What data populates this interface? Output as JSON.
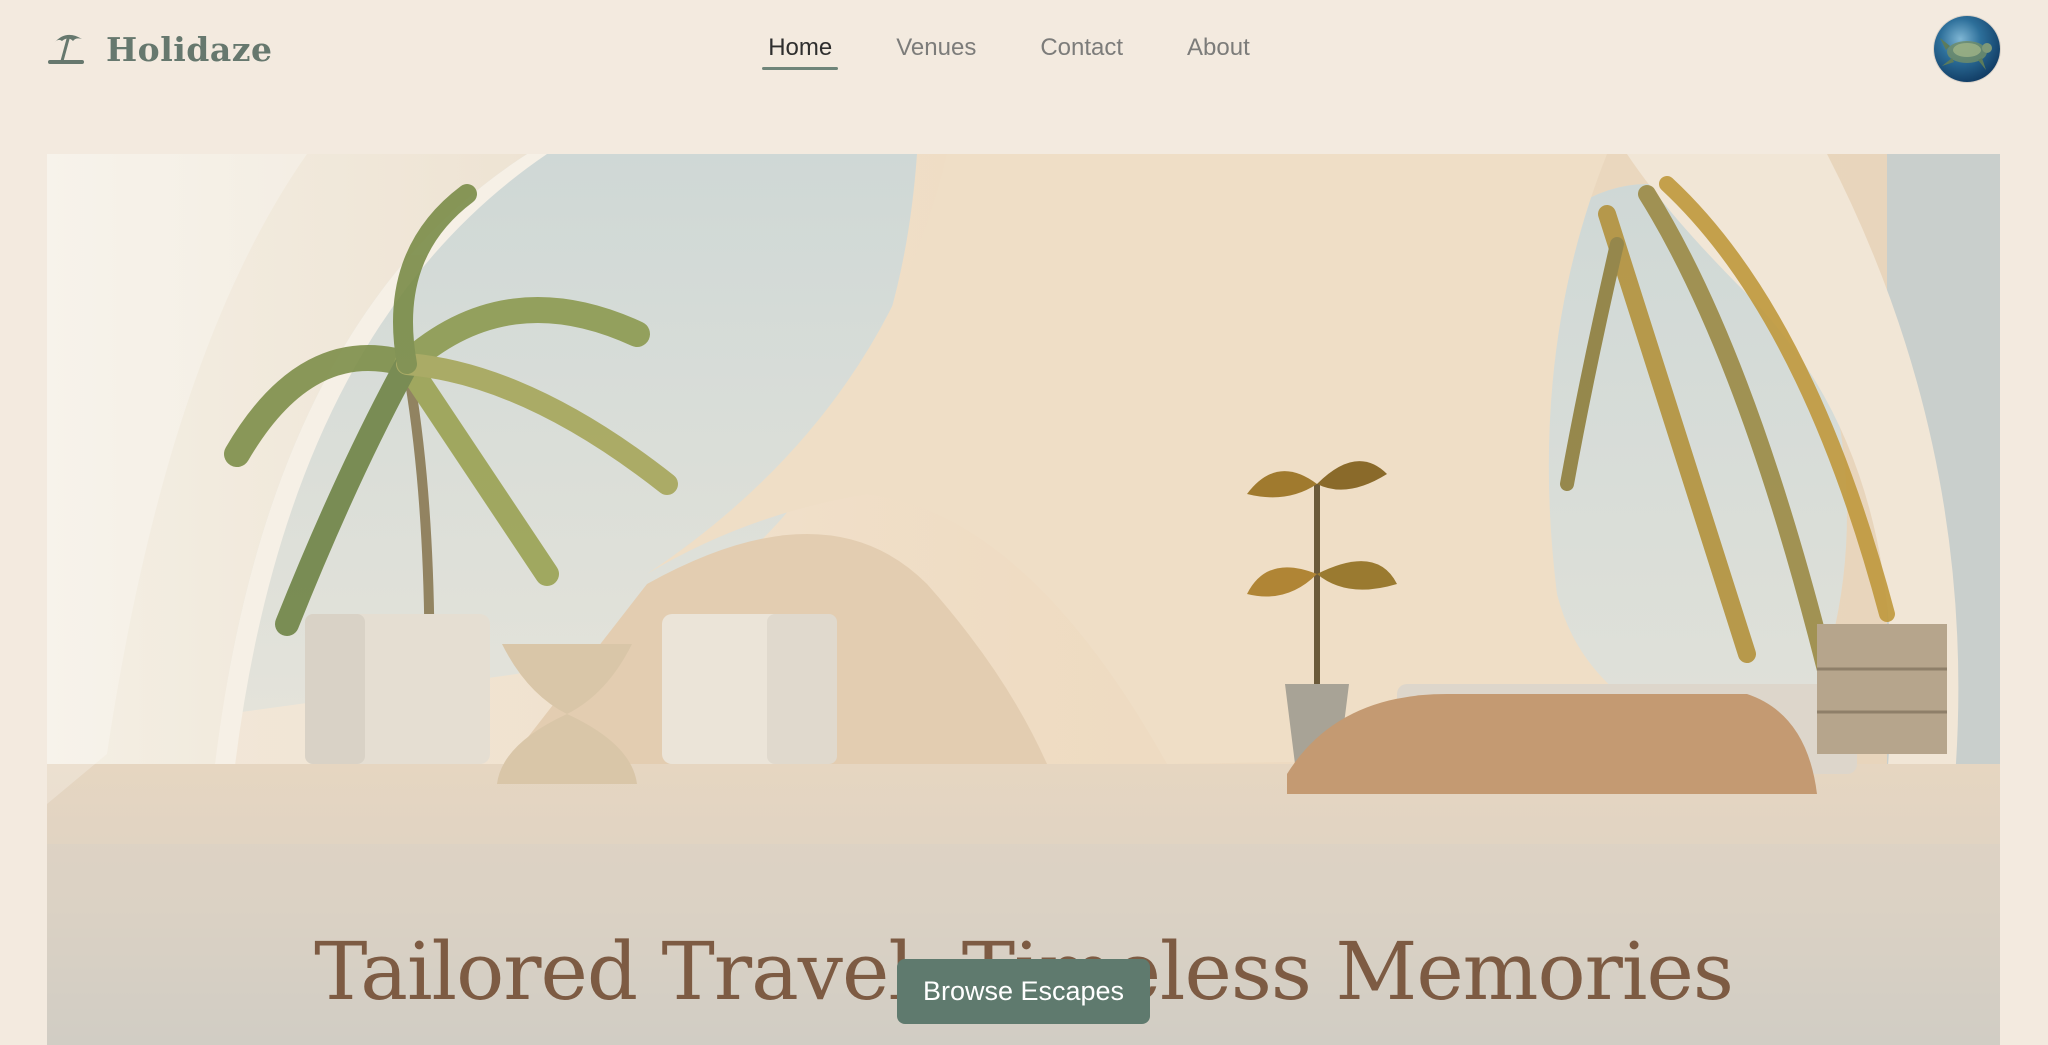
{
  "header": {
    "brand": {
      "name": "Holidaze",
      "icon": "beach-umbrella-icon"
    },
    "nav": [
      {
        "label": "Home",
        "active": true
      },
      {
        "label": "Venues",
        "active": false
      },
      {
        "label": "Contact",
        "active": false
      },
      {
        "label": "About",
        "active": false
      }
    ],
    "avatar": {
      "icon": "user-avatar-turtle"
    }
  },
  "hero": {
    "title": "Tailored Travel, Timeless Memories",
    "cta_label": "Browse Escapes",
    "image": "interior-arches-palms-bedroom"
  },
  "colors": {
    "background": "#f3eadf",
    "brand": "#66786e",
    "accent": "#5f7a6e",
    "title": "#7d5b43"
  }
}
